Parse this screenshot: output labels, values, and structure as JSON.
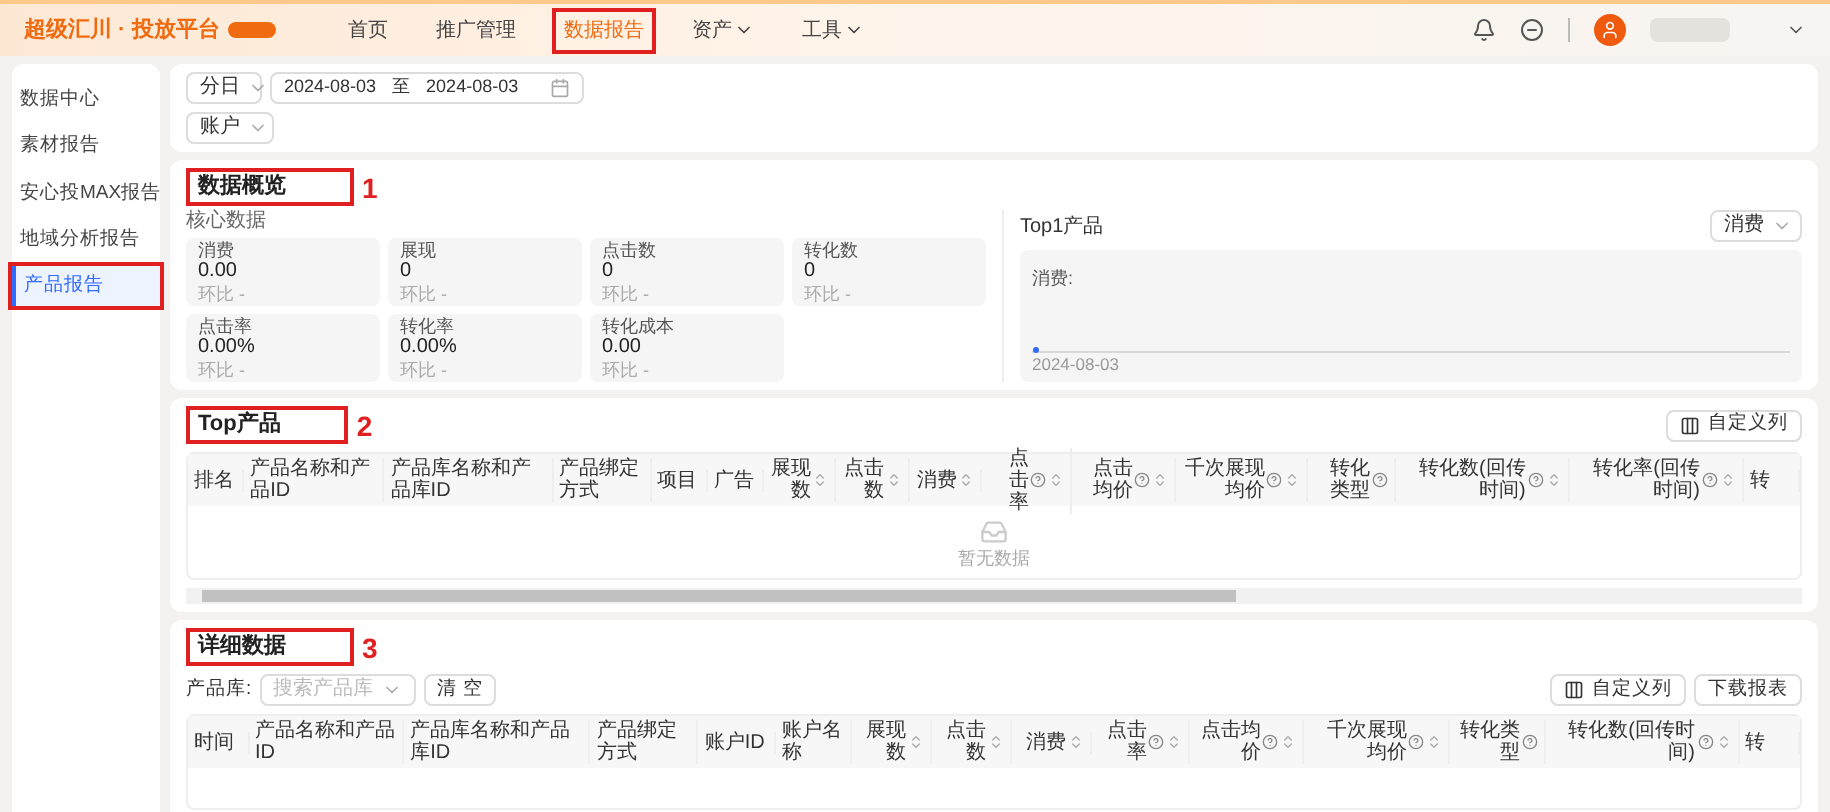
{
  "header": {
    "logo": "超级汇川 · 投放平台",
    "nav": [
      {
        "label": "首页",
        "selected": false,
        "dropdown": false,
        "highlighted": false
      },
      {
        "label": "推广管理",
        "selected": false,
        "dropdown": false,
        "highlighted": false
      },
      {
        "label": "数据报告",
        "selected": true,
        "dropdown": false,
        "highlighted": true
      },
      {
        "label": "资产",
        "selected": false,
        "dropdown": true,
        "highlighted": false
      },
      {
        "label": "工具",
        "selected": false,
        "dropdown": true,
        "highlighted": false
      }
    ]
  },
  "sidebar": {
    "items": [
      {
        "label": "数据中心",
        "selected": false,
        "highlighted": false
      },
      {
        "label": "素材报告",
        "selected": false,
        "highlighted": false
      },
      {
        "label": "安心投MAX报告",
        "selected": false,
        "highlighted": false
      },
      {
        "label": "地域分析报告",
        "selected": false,
        "highlighted": false
      },
      {
        "label": "产品报告",
        "selected": true,
        "highlighted": true
      }
    ]
  },
  "filters": {
    "granularity": "分日",
    "date_start": "2024-08-03",
    "date_separator": "至",
    "date_end": "2024-08-03",
    "level": "账户"
  },
  "overview": {
    "title": "数据概览",
    "annotation": "1",
    "subtitle": "核心数据",
    "metrics": [
      {
        "label": "消费",
        "value": "0.00",
        "compare": "环比 -"
      },
      {
        "label": "展现",
        "value": "0",
        "compare": "环比 -"
      },
      {
        "label": "点击数",
        "value": "0",
        "compare": "环比 -"
      },
      {
        "label": "转化数",
        "value": "0",
        "compare": "环比 -"
      },
      {
        "label": "点击率",
        "value": "0.00%",
        "compare": "环比 -"
      },
      {
        "label": "转化率",
        "value": "0.00%",
        "compare": "环比 -"
      },
      {
        "label": "转化成本",
        "value": "0.00",
        "compare": "环比 -"
      }
    ],
    "top1": {
      "title": "Top1产品",
      "metric_select": "消费",
      "series_label": "消费:",
      "x_label": "2024-08-03"
    }
  },
  "top_products": {
    "title": "Top产品",
    "annotation": "2",
    "columns_button": "自定义列",
    "empty_text": "暂无数据",
    "columns": [
      {
        "label": "排名",
        "help": false,
        "sortable": false
      },
      {
        "label": "产品名称和产品ID",
        "help": false,
        "sortable": false
      },
      {
        "label": "产品库名称和产品库ID",
        "help": false,
        "sortable": false
      },
      {
        "label": "产品绑定方式",
        "help": false,
        "sortable": false
      },
      {
        "label": "项目",
        "help": false,
        "sortable": false
      },
      {
        "label": "广告",
        "help": false,
        "sortable": false
      },
      {
        "label": "展现数",
        "help": false,
        "sortable": true
      },
      {
        "label": "点击数",
        "help": false,
        "sortable": true
      },
      {
        "label": "消费",
        "help": false,
        "sortable": true
      },
      {
        "label": "点击率",
        "help": true,
        "sortable": true
      },
      {
        "label": "点击均价",
        "help": true,
        "sortable": true
      },
      {
        "label": "千次展现均价",
        "help": true,
        "sortable": true
      },
      {
        "label": "转化类型",
        "help": true,
        "sortable": false
      },
      {
        "label": "转化数(回传时间)",
        "help": true,
        "sortable": true
      },
      {
        "label": "转化率(回传时间)",
        "help": true,
        "sortable": true
      },
      {
        "label": "转",
        "help": false,
        "sortable": false
      }
    ]
  },
  "details": {
    "title": "详细数据",
    "annotation": "3",
    "library_label": "产品库:",
    "library_placeholder": "搜索产品库",
    "clear_button": "清 空",
    "columns_button": "自定义列",
    "download_button": "下载报表",
    "columns": [
      {
        "label": "时间",
        "help": false,
        "sortable": false
      },
      {
        "label": "产品名称和产品ID",
        "help": false,
        "sortable": false
      },
      {
        "label": "产品库名称和产品库ID",
        "help": false,
        "sortable": false
      },
      {
        "label": "产品绑定方式",
        "help": false,
        "sortable": false
      },
      {
        "label": "账户ID",
        "help": false,
        "sortable": false
      },
      {
        "label": "账户名称",
        "help": false,
        "sortable": false
      },
      {
        "label": "展现数",
        "help": false,
        "sortable": true
      },
      {
        "label": "点击数",
        "help": false,
        "sortable": true
      },
      {
        "label": "消费",
        "help": false,
        "sortable": true
      },
      {
        "label": "点击率",
        "help": true,
        "sortable": true
      },
      {
        "label": "点击均价",
        "help": true,
        "sortable": true
      },
      {
        "label": "千次展现均价",
        "help": true,
        "sortable": true
      },
      {
        "label": "转化类型",
        "help": true,
        "sortable": false
      },
      {
        "label": "转化数(回传时间)",
        "help": true,
        "sortable": true
      },
      {
        "label": "转",
        "help": false,
        "sortable": false
      }
    ]
  }
}
